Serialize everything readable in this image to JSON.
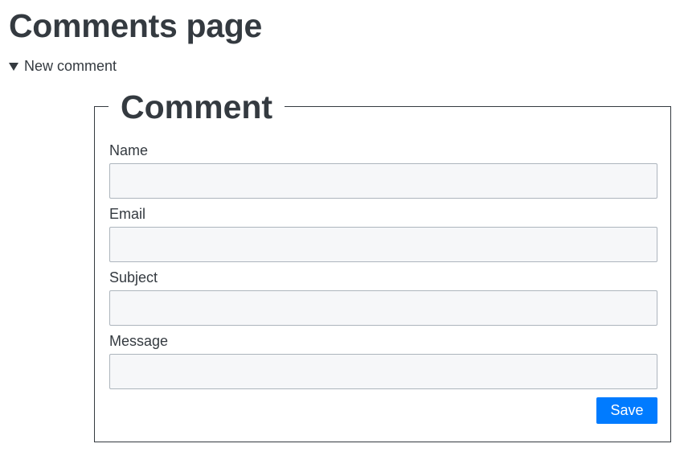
{
  "page": {
    "title": "Comments page"
  },
  "details": {
    "summary": "New comment",
    "expanded": true
  },
  "form": {
    "legend": "Comment",
    "fields": [
      {
        "label": "Name",
        "value": "",
        "placeholder": ""
      },
      {
        "label": "Email",
        "value": "",
        "placeholder": ""
      },
      {
        "label": "Subject",
        "value": "",
        "placeholder": ""
      },
      {
        "label": "Message",
        "value": "",
        "placeholder": ""
      }
    ],
    "save_label": "Save"
  },
  "colors": {
    "text": "#343a40",
    "input_bg": "#f6f7f9",
    "input_border": "#adb5bd",
    "primary": "#007bff"
  }
}
